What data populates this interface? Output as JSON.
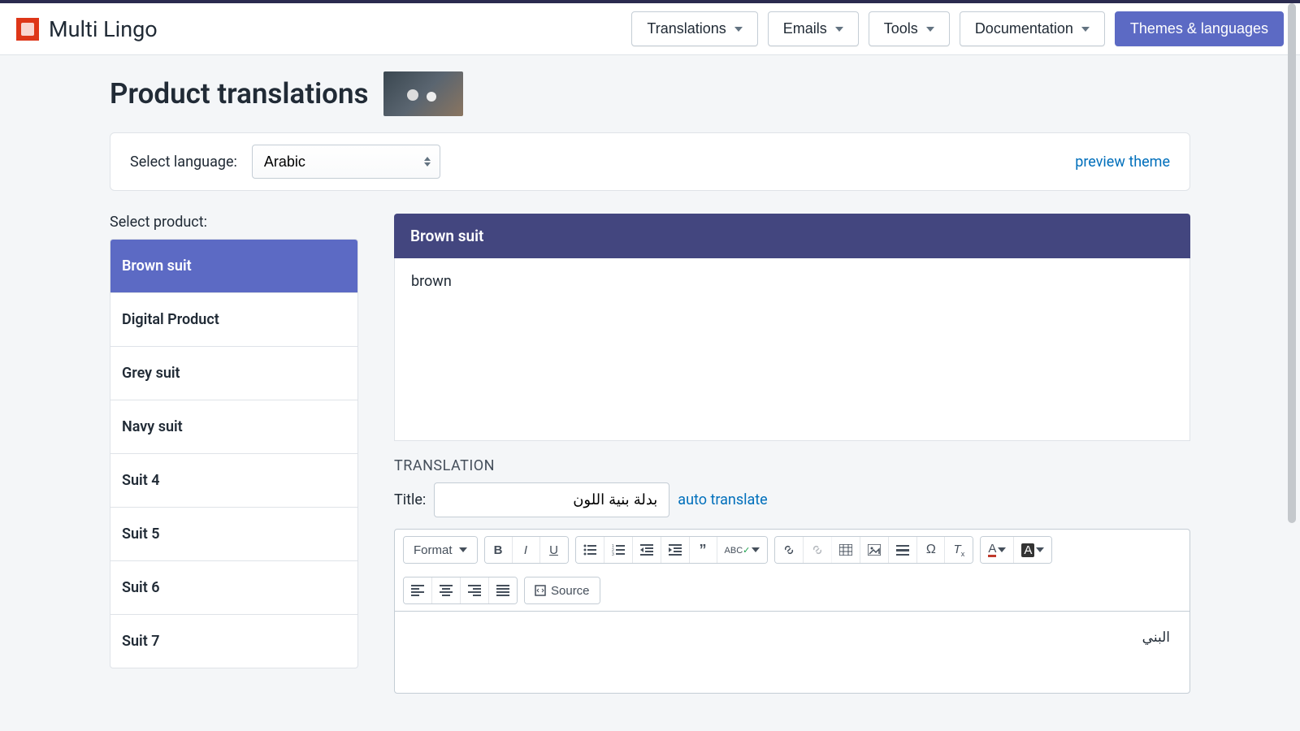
{
  "brand": {
    "name": "Multi Lingo"
  },
  "nav": {
    "translations": "Translations",
    "emails": "Emails",
    "tools": "Tools",
    "documentation": "Documentation",
    "themes": "Themes & languages"
  },
  "page": {
    "title": "Product translations",
    "select_language_label": "Select language:",
    "language_value": "Arabic",
    "preview_link": "preview theme",
    "select_product_label": "Select product:"
  },
  "products": [
    {
      "name": "Brown suit",
      "active": true
    },
    {
      "name": "Digital Product"
    },
    {
      "name": "Grey suit"
    },
    {
      "name": "Navy suit"
    },
    {
      "name": "Suit 4"
    },
    {
      "name": "Suit 5"
    },
    {
      "name": "Suit 6"
    },
    {
      "name": "Suit 7"
    }
  ],
  "source": {
    "title": "Brown suit",
    "body": "brown"
  },
  "translation": {
    "section_label": "TRANSLATION",
    "title_label": "Title:",
    "title_value": "بدلة بنية اللون",
    "auto_translate": "auto translate",
    "body": "البني"
  },
  "editor": {
    "format_label": "Format",
    "source_label": "Source"
  }
}
